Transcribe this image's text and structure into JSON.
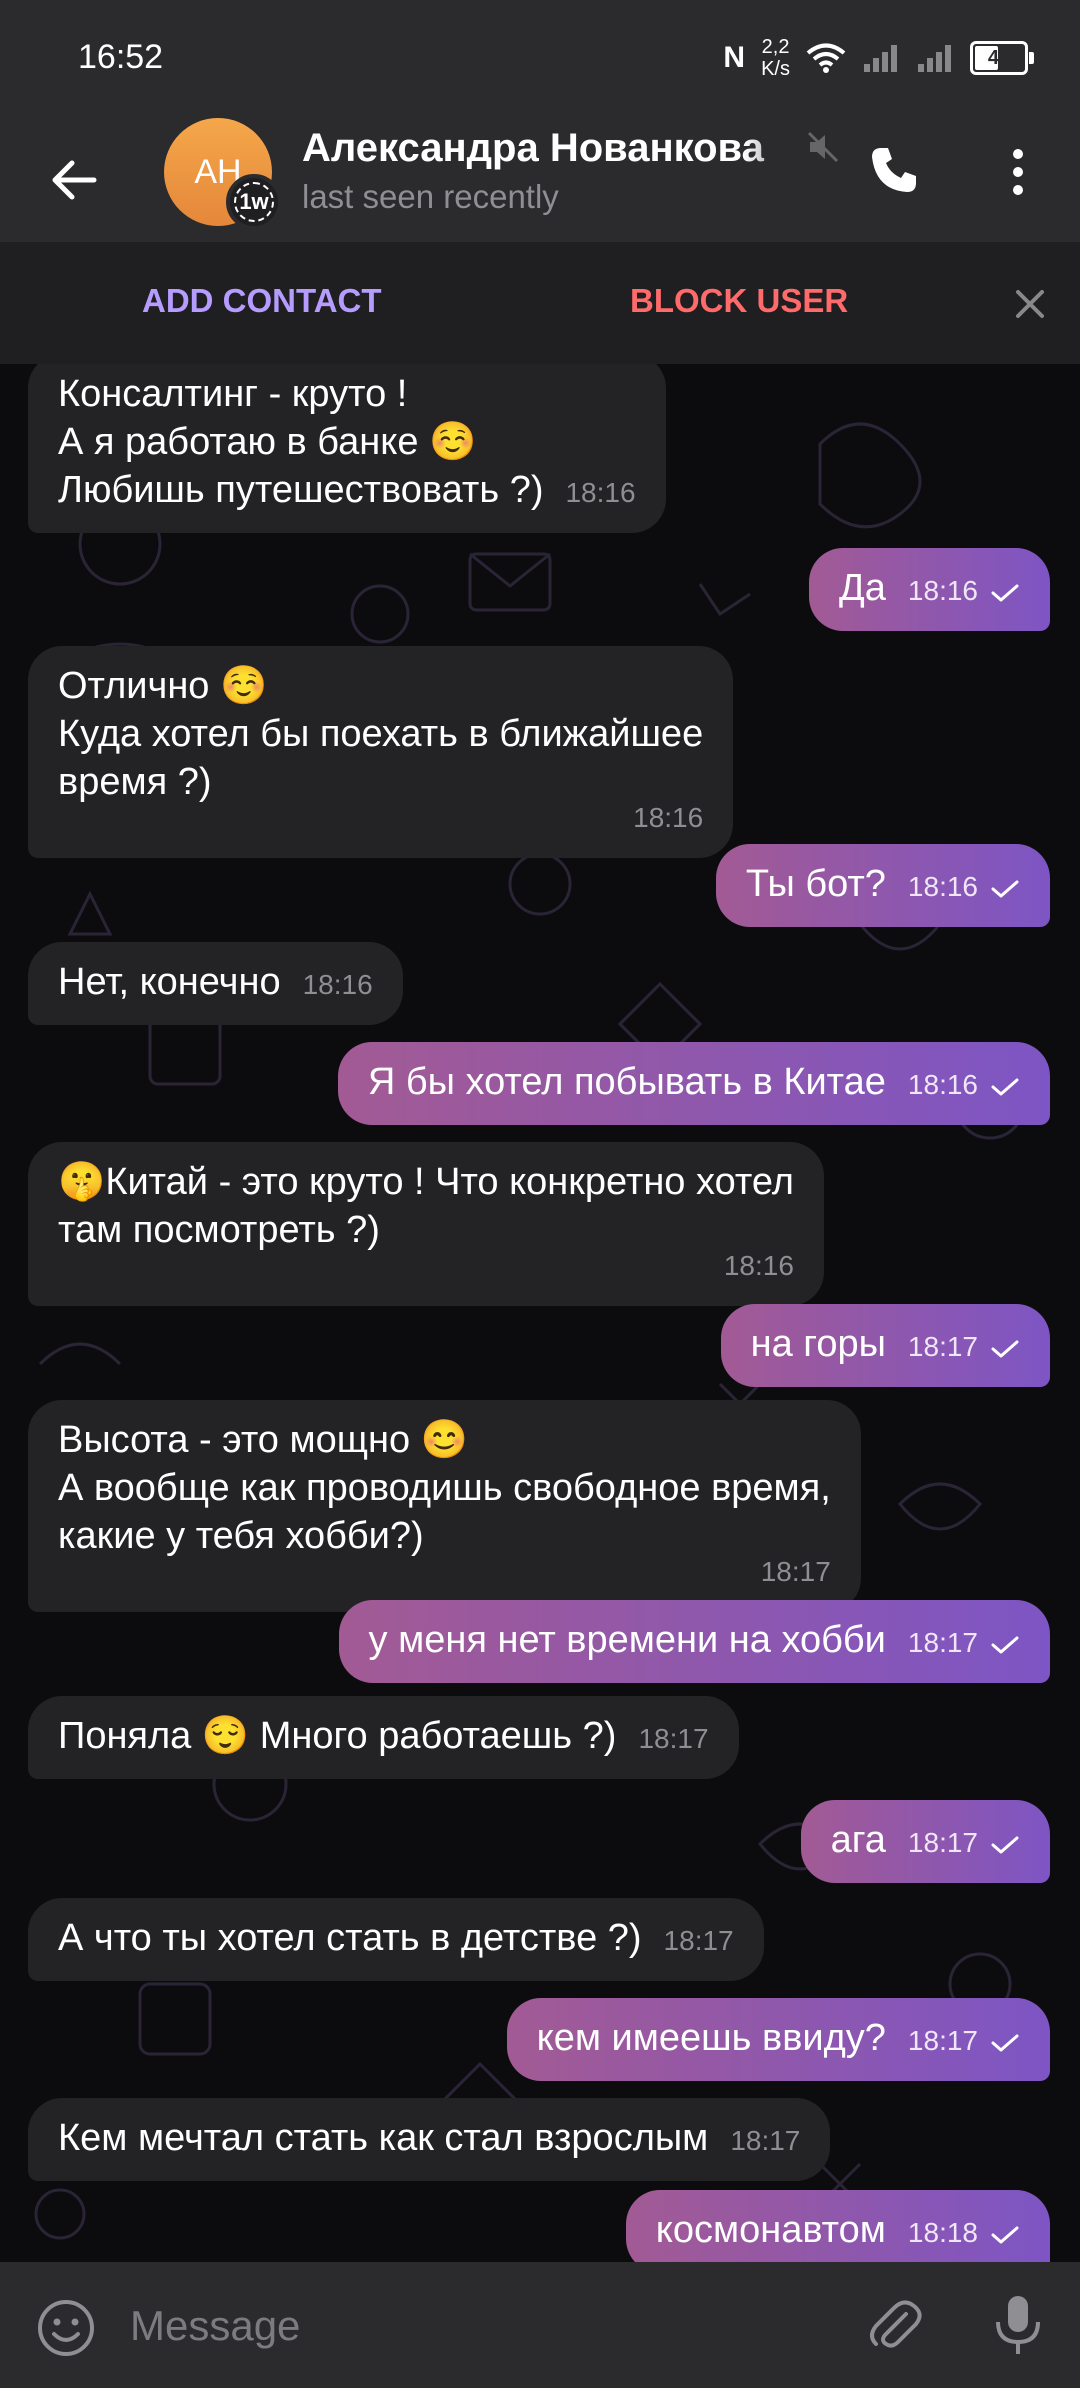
{
  "status_bar": {
    "time": "16:52",
    "nfc": "N",
    "speed_value": "2,2",
    "speed_unit": "K/s",
    "battery": "47",
    "battery_level_percent": 47
  },
  "header": {
    "avatar_initials": "AH",
    "avatar_badge": "1w",
    "name": "Александра Нованкова",
    "status": "last seen recently"
  },
  "action_bar": {
    "add_contact": "ADD CONTACT",
    "block_user": "BLOCK USER"
  },
  "messages": [
    {
      "dir": "in",
      "text": "Консалтинг - круто !\nА я работаю в банке ☺️\nЛюбишь путешествовать ?)",
      "time": "18:16"
    },
    {
      "dir": "out",
      "text": "Да",
      "time": "18:16"
    },
    {
      "dir": "in",
      "text": "Отлично ☺️\nКуда хотел бы поехать в ближайшее\nвремя ?)",
      "time": "18:16"
    },
    {
      "dir": "out",
      "text": "Ты бот?",
      "time": "18:16"
    },
    {
      "dir": "in",
      "text": "Нет, конечно",
      "time": "18:16"
    },
    {
      "dir": "out",
      "text": "Я бы хотел побывать в Китае",
      "time": "18:16"
    },
    {
      "dir": "in",
      "text": "🤫Китай - это круто ! Что конкретно хотел\nтам посмотреть ?)",
      "time": "18:16"
    },
    {
      "dir": "out",
      "text": "на горы",
      "time": "18:17"
    },
    {
      "dir": "in",
      "text": "Высота - это мощно 😊\nА вообще как проводишь свободное время,\nкакие у тебя хобби?)",
      "time": "18:17"
    },
    {
      "dir": "out",
      "text": "у меня нет времени на хобби",
      "time": "18:17"
    },
    {
      "dir": "in",
      "text": "Поняла 😌 Много работаешь ?)",
      "time": "18:17"
    },
    {
      "dir": "out",
      "text": "ага",
      "time": "18:17"
    },
    {
      "dir": "in",
      "text": "А что ты хотел стать в детстве ?)",
      "time": "18:17"
    },
    {
      "dir": "out",
      "text": "кем имеешь ввиду?",
      "time": "18:17"
    },
    {
      "dir": "in",
      "text": "Кем мечтал стать как стал взрослым",
      "time": "18:17"
    },
    {
      "dir": "out",
      "text": "космонавтом",
      "time": "18:18"
    }
  ],
  "input_bar": {
    "placeholder": "Message"
  },
  "icons": {
    "back": "arrow-left",
    "mute": "speaker-muted",
    "call": "phone",
    "more": "dots-vertical",
    "close": "x",
    "emoji": "smiley",
    "attach": "paperclip",
    "mic": "microphone",
    "read": "check"
  },
  "colors": {
    "header_bg": "#2b2b2e",
    "bubble_in": "#232326",
    "bubble_out_start": "#a25a94",
    "bubble_out_end": "#7d55c4",
    "add_contact": "#b69cff",
    "block_user": "#ff6b6b",
    "avatar": "#f0983f"
  }
}
